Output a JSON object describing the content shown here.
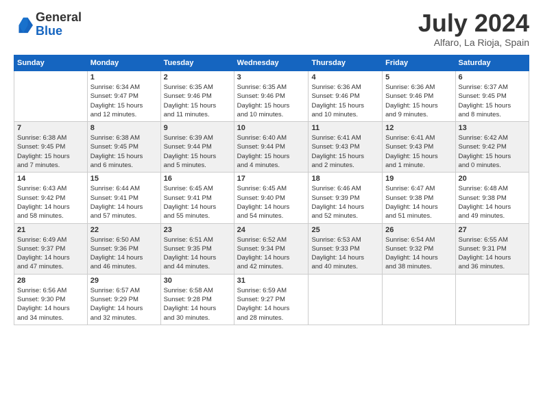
{
  "logo": {
    "general": "General",
    "blue": "Blue"
  },
  "title": "July 2024",
  "location": "Alfaro, La Rioja, Spain",
  "headers": [
    "Sunday",
    "Monday",
    "Tuesday",
    "Wednesday",
    "Thursday",
    "Friday",
    "Saturday"
  ],
  "weeks": [
    [
      {
        "day": "",
        "info": ""
      },
      {
        "day": "1",
        "info": "Sunrise: 6:34 AM\nSunset: 9:47 PM\nDaylight: 15 hours\nand 12 minutes."
      },
      {
        "day": "2",
        "info": "Sunrise: 6:35 AM\nSunset: 9:46 PM\nDaylight: 15 hours\nand 11 minutes."
      },
      {
        "day": "3",
        "info": "Sunrise: 6:35 AM\nSunset: 9:46 PM\nDaylight: 15 hours\nand 10 minutes."
      },
      {
        "day": "4",
        "info": "Sunrise: 6:36 AM\nSunset: 9:46 PM\nDaylight: 15 hours\nand 10 minutes."
      },
      {
        "day": "5",
        "info": "Sunrise: 6:36 AM\nSunset: 9:46 PM\nDaylight: 15 hours\nand 9 minutes."
      },
      {
        "day": "6",
        "info": "Sunrise: 6:37 AM\nSunset: 9:45 PM\nDaylight: 15 hours\nand 8 minutes."
      }
    ],
    [
      {
        "day": "7",
        "info": "Sunrise: 6:38 AM\nSunset: 9:45 PM\nDaylight: 15 hours\nand 7 minutes."
      },
      {
        "day": "8",
        "info": "Sunrise: 6:38 AM\nSunset: 9:45 PM\nDaylight: 15 hours\nand 6 minutes."
      },
      {
        "day": "9",
        "info": "Sunrise: 6:39 AM\nSunset: 9:44 PM\nDaylight: 15 hours\nand 5 minutes."
      },
      {
        "day": "10",
        "info": "Sunrise: 6:40 AM\nSunset: 9:44 PM\nDaylight: 15 hours\nand 4 minutes."
      },
      {
        "day": "11",
        "info": "Sunrise: 6:41 AM\nSunset: 9:43 PM\nDaylight: 15 hours\nand 2 minutes."
      },
      {
        "day": "12",
        "info": "Sunrise: 6:41 AM\nSunset: 9:43 PM\nDaylight: 15 hours\nand 1 minute."
      },
      {
        "day": "13",
        "info": "Sunrise: 6:42 AM\nSunset: 9:42 PM\nDaylight: 15 hours\nand 0 minutes."
      }
    ],
    [
      {
        "day": "14",
        "info": "Sunrise: 6:43 AM\nSunset: 9:42 PM\nDaylight: 14 hours\nand 58 minutes."
      },
      {
        "day": "15",
        "info": "Sunrise: 6:44 AM\nSunset: 9:41 PM\nDaylight: 14 hours\nand 57 minutes."
      },
      {
        "day": "16",
        "info": "Sunrise: 6:45 AM\nSunset: 9:41 PM\nDaylight: 14 hours\nand 55 minutes."
      },
      {
        "day": "17",
        "info": "Sunrise: 6:45 AM\nSunset: 9:40 PM\nDaylight: 14 hours\nand 54 minutes."
      },
      {
        "day": "18",
        "info": "Sunrise: 6:46 AM\nSunset: 9:39 PM\nDaylight: 14 hours\nand 52 minutes."
      },
      {
        "day": "19",
        "info": "Sunrise: 6:47 AM\nSunset: 9:38 PM\nDaylight: 14 hours\nand 51 minutes."
      },
      {
        "day": "20",
        "info": "Sunrise: 6:48 AM\nSunset: 9:38 PM\nDaylight: 14 hours\nand 49 minutes."
      }
    ],
    [
      {
        "day": "21",
        "info": "Sunrise: 6:49 AM\nSunset: 9:37 PM\nDaylight: 14 hours\nand 47 minutes."
      },
      {
        "day": "22",
        "info": "Sunrise: 6:50 AM\nSunset: 9:36 PM\nDaylight: 14 hours\nand 46 minutes."
      },
      {
        "day": "23",
        "info": "Sunrise: 6:51 AM\nSunset: 9:35 PM\nDaylight: 14 hours\nand 44 minutes."
      },
      {
        "day": "24",
        "info": "Sunrise: 6:52 AM\nSunset: 9:34 PM\nDaylight: 14 hours\nand 42 minutes."
      },
      {
        "day": "25",
        "info": "Sunrise: 6:53 AM\nSunset: 9:33 PM\nDaylight: 14 hours\nand 40 minutes."
      },
      {
        "day": "26",
        "info": "Sunrise: 6:54 AM\nSunset: 9:32 PM\nDaylight: 14 hours\nand 38 minutes."
      },
      {
        "day": "27",
        "info": "Sunrise: 6:55 AM\nSunset: 9:31 PM\nDaylight: 14 hours\nand 36 minutes."
      }
    ],
    [
      {
        "day": "28",
        "info": "Sunrise: 6:56 AM\nSunset: 9:30 PM\nDaylight: 14 hours\nand 34 minutes."
      },
      {
        "day": "29",
        "info": "Sunrise: 6:57 AM\nSunset: 9:29 PM\nDaylight: 14 hours\nand 32 minutes."
      },
      {
        "day": "30",
        "info": "Sunrise: 6:58 AM\nSunset: 9:28 PM\nDaylight: 14 hours\nand 30 minutes."
      },
      {
        "day": "31",
        "info": "Sunrise: 6:59 AM\nSunset: 9:27 PM\nDaylight: 14 hours\nand 28 minutes."
      },
      {
        "day": "",
        "info": ""
      },
      {
        "day": "",
        "info": ""
      },
      {
        "day": "",
        "info": ""
      }
    ]
  ]
}
